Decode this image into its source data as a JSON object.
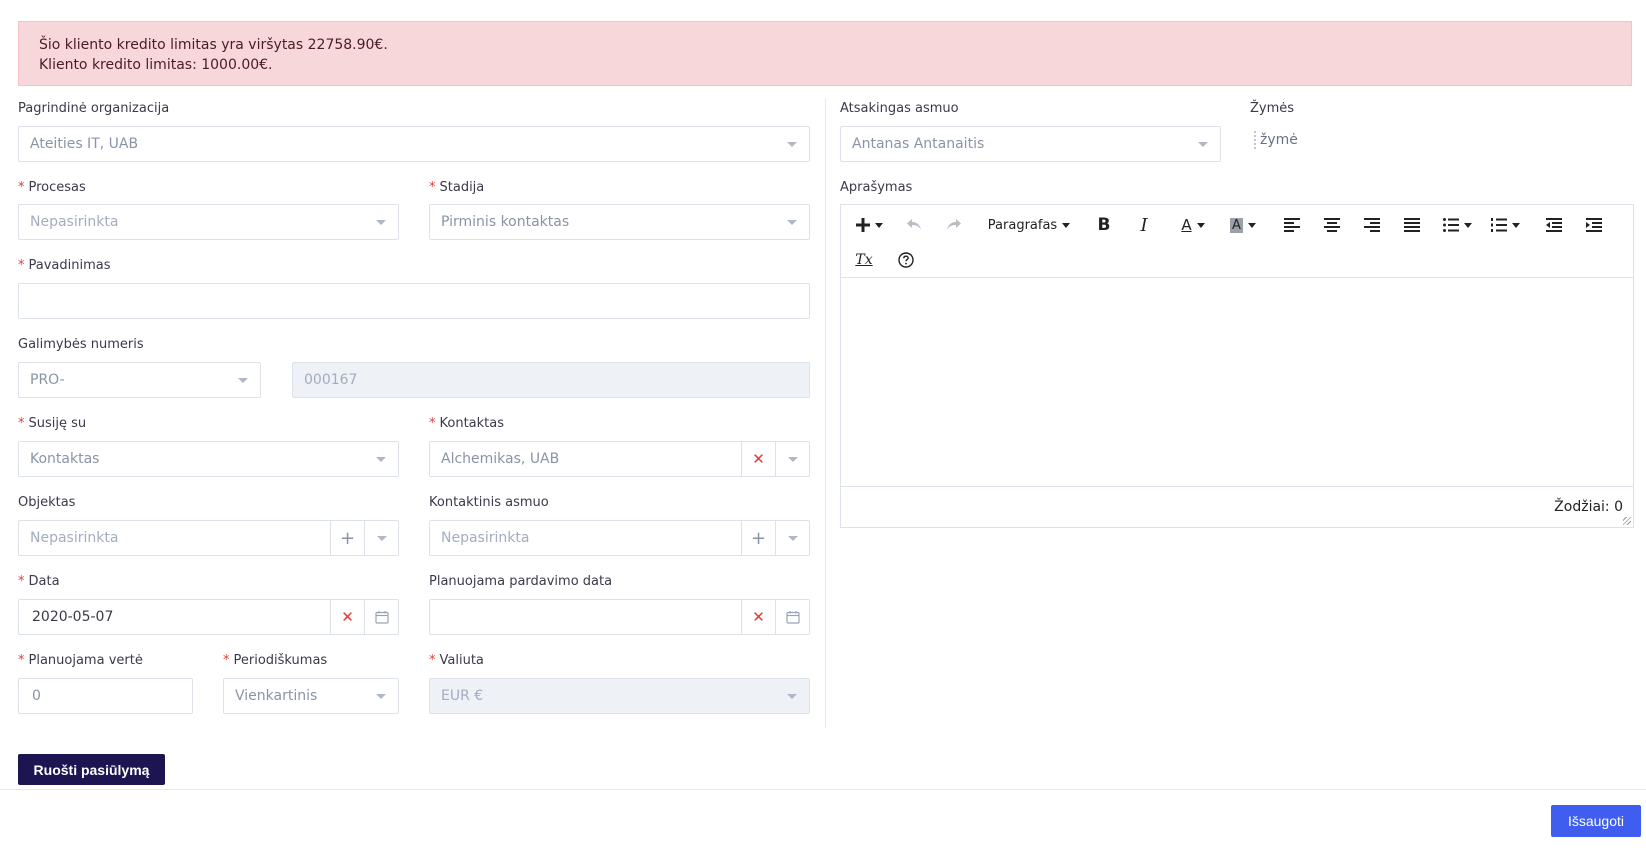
{
  "alert": {
    "line1": "Šio kliento kredito limitas yra viršytas 22758.90€.",
    "line2": "Kliento kredito limitas: 1000.00€."
  },
  "form": {
    "pagrindine_organizacija": {
      "label": "Pagrindinė organizacija",
      "value": "Ateities IT, UAB"
    },
    "procesas": {
      "label": "Procesas",
      "placeholder": "Nepasirinkta"
    },
    "stadija": {
      "label": "Stadija",
      "value": "Pirminis kontaktas"
    },
    "pavadinimas": {
      "label": "Pavadinimas",
      "value": ""
    },
    "galimybes_numeris": {
      "label": "Galimybės numeris",
      "prefix": "PRO-",
      "number": "000167"
    },
    "susije_su": {
      "label": "Susiję su",
      "value": "Kontaktas"
    },
    "kontaktas": {
      "label": "Kontaktas",
      "value": "Alchemikas, UAB"
    },
    "objektas": {
      "label": "Objektas",
      "placeholder": "Nepasirinkta"
    },
    "kontaktinis_asmuo": {
      "label": "Kontaktinis asmuo",
      "placeholder": "Nepasirinkta"
    },
    "data": {
      "label": "Data",
      "value": "2020-05-07"
    },
    "planuojama_pardavimo_data": {
      "label": "Planuojama pardavimo data",
      "value": ""
    },
    "planuojama_verte": {
      "label": "Planuojama vertė",
      "value": "0"
    },
    "periodiskumas": {
      "label": "Periodiškumas",
      "value": "Vienkartinis"
    },
    "valiuta": {
      "label": "Valiuta",
      "value": "EUR €"
    },
    "atsakingas_asmuo": {
      "label": "Atsakingas asmuo",
      "value": "Antanas Antanaitis"
    },
    "zymes": {
      "label": "Žymės",
      "placeholder": "žymė"
    },
    "aprasymas": {
      "label": "Aprašymas"
    }
  },
  "editor": {
    "paragraph_label": "Paragrafas",
    "word_count": "Žodžiai: 0",
    "bold_glyph": "B",
    "italic_glyph": "I",
    "font_color_glyph": "A",
    "bg_color_glyph": "A",
    "clear_format_glyph": "Tx"
  },
  "buttons": {
    "prepare_offer": "Ruošti pasiūlymą",
    "save": "Išsaugoti"
  },
  "glyphs": {
    "clear": "✕",
    "plus": "+"
  },
  "colors": {
    "alert_bg": "#f8d7da",
    "primary_dark": "#1d1452",
    "primary_blue": "#3f5ef0",
    "required": "#e53935"
  }
}
